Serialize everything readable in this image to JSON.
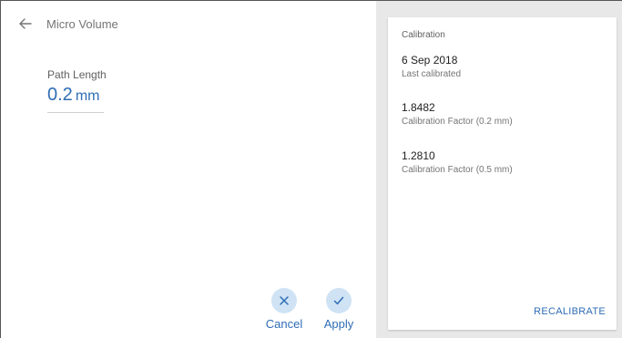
{
  "header": {
    "title": "Micro Volume",
    "back_icon": "arrow-left-icon"
  },
  "path_length": {
    "label": "Path Length",
    "value": "0.2",
    "unit": "mm"
  },
  "actions": {
    "cancel_label": "Cancel",
    "cancel_icon": "close-icon",
    "apply_label": "Apply",
    "apply_icon": "check-icon"
  },
  "calibration": {
    "title": "Calibration",
    "entries": [
      {
        "value": "6 Sep 2018",
        "caption": "Last calibrated"
      },
      {
        "value": "1.8482",
        "caption": "Calibration Factor (0.2 mm)"
      },
      {
        "value": "1.2810",
        "caption": "Calibration Factor (0.5 mm)"
      }
    ],
    "recalibrate_label": "RECALIBRATE"
  },
  "colors": {
    "accent": "#2f6db5",
    "button_circle": "#cfe3f5",
    "panel_bg": "#e8e8e8"
  }
}
